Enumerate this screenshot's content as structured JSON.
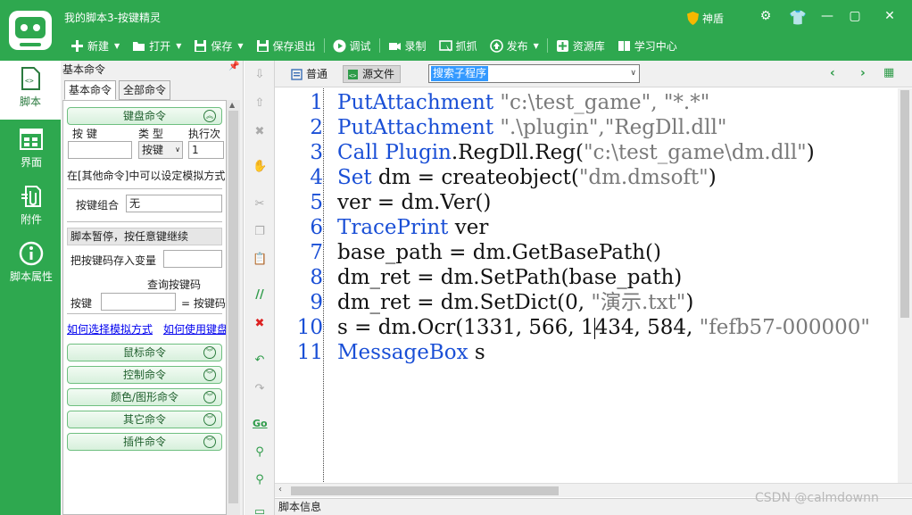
{
  "window": {
    "title": "我的脚本3-按键精灵",
    "shendun_label": "神盾",
    "controls": {
      "settings": "⚙",
      "minimize": "—",
      "maximize": "▢",
      "close": "✕"
    }
  },
  "toolbar": {
    "new": "新建",
    "open": "打开",
    "save": "保存",
    "save_exit": "保存退出",
    "debug": "调试",
    "record": "录制",
    "capture": "抓抓",
    "publish": "发布",
    "resources": "资源库",
    "learning": "学习中心"
  },
  "leftnav": {
    "script": "脚本",
    "ui": "界面",
    "attachment": "附件",
    "properties": "脚本属性"
  },
  "command_panel": {
    "title": "基本命令",
    "tab_basic": "基本命令",
    "tab_all": "全部命令",
    "keyboard_group": "键盘命令",
    "key_label": "按 键",
    "type_label": "类 型",
    "exec_label": "执行次",
    "type_value": "按键",
    "exec_value": "1",
    "other_cmd_note": "在[其他命令]中可以设定模拟方式",
    "combo_label": "按键组合",
    "combo_value": "无",
    "pause_text": "脚本暂停，按任意键继续",
    "store_key_label": "把按键码存入变量",
    "query_keycode": "查询按键码",
    "key_label2": "按键",
    "eq_keycode": "= 按键码",
    "link_choose_sim": "如何选择模拟方式",
    "link_how_use": "如何使用键盘",
    "groups": [
      "鼠标命令",
      "控制命令",
      "颜色/图形命令",
      "其它命令",
      "插件命令"
    ]
  },
  "editor": {
    "tab_normal": "普通",
    "tab_source": "源文件",
    "search_combo": "搜索子程序",
    "line_numbers": [
      "1",
      "2",
      "3",
      "4",
      "5",
      "6",
      "7",
      "8",
      "9",
      "10",
      "11"
    ],
    "lines": [
      [
        {
          "t": "PutAttachment ",
          "c": "kw"
        },
        {
          "t": "\"c:\\test_game\", \"*.*\"",
          "c": "st"
        }
      ],
      [
        {
          "t": "PutAttachment ",
          "c": "kw"
        },
        {
          "t": "\".\\plugin\",\"RegDll.dll\"",
          "c": "st"
        }
      ],
      [
        {
          "t": "Call Plugin",
          "c": "kw"
        },
        {
          "t": ".RegDll.Reg(",
          "c": ""
        },
        {
          "t": "\"c:\\test_game\\dm.dll\"",
          "c": "st"
        },
        {
          "t": ")",
          "c": ""
        }
      ],
      [
        {
          "t": "Set ",
          "c": "kw"
        },
        {
          "t": "dm = createobject(",
          "c": ""
        },
        {
          "t": "\"dm.dmsoft\"",
          "c": "st"
        },
        {
          "t": ")",
          "c": ""
        }
      ],
      [
        {
          "t": "ver = dm.Ver()",
          "c": ""
        }
      ],
      [
        {
          "t": "TracePrint ",
          "c": "kw"
        },
        {
          "t": "ver",
          "c": ""
        }
      ],
      [
        {
          "t": "base_path = dm.GetBasePath()",
          "c": ""
        }
      ],
      [
        {
          "t": "dm_ret = dm.SetPath(base_path)",
          "c": ""
        }
      ],
      [
        {
          "t": "dm_ret = dm.SetDict(0, ",
          "c": ""
        },
        {
          "t": "\"演示.txt\"",
          "c": "st"
        },
        {
          "t": ")",
          "c": ""
        }
      ],
      [
        {
          "t": "s = dm.Ocr(1331, 566, 1",
          "c": ""
        },
        {
          "t": "|",
          "c": "caret"
        },
        {
          "t": "434, 584, ",
          "c": ""
        },
        {
          "t": "\"fefb57-000000\"",
          "c": "st"
        }
      ],
      [
        {
          "t": "MessageBox ",
          "c": "kw"
        },
        {
          "t": "s",
          "c": ""
        }
      ]
    ]
  },
  "status": {
    "script_info": "脚本信息"
  },
  "watermark": "CSDN @calmdownn",
  "colors": {
    "brand_green": "#2ea84f",
    "keyword_blue": "#1a4fd6",
    "string_gray": "#7a7a7a"
  }
}
